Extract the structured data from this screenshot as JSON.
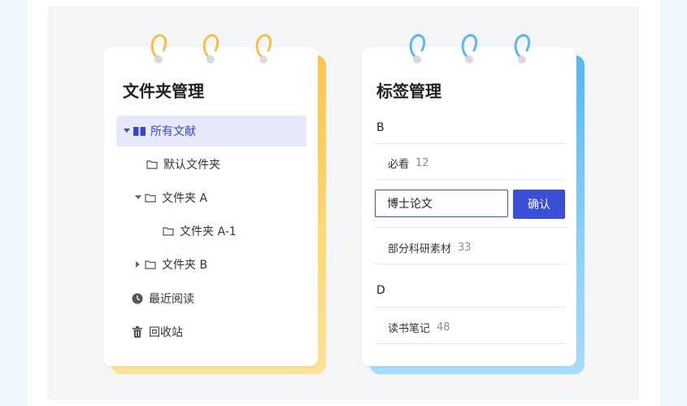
{
  "colors": {
    "accent": "#3b4ed6",
    "active_bg": "#e6e9fa",
    "yellow_ring": "#f3c04a",
    "blue_ring": "#5db6ef"
  },
  "folder_panel": {
    "title": "文件夹管理",
    "items": [
      {
        "label": "所有文献",
        "icon": "book-icon",
        "caret": "caret-down-icon",
        "active": true
      },
      {
        "label": "默认文件夹",
        "icon": "folder-icon"
      },
      {
        "label": "文件夹 A",
        "icon": "folder-icon",
        "caret": "caret-down-icon"
      },
      {
        "label": "文件夹 A-1",
        "icon": "folder-icon"
      },
      {
        "label": "文件夹 B",
        "icon": "folder-icon",
        "caret": "caret-right-icon"
      },
      {
        "label": "最近阅读",
        "icon": "clock-icon"
      },
      {
        "label": "回收站",
        "icon": "trash-icon"
      }
    ]
  },
  "tag_panel": {
    "title": "标签管理",
    "sections": [
      {
        "letter": "B"
      },
      {
        "letter": "D"
      }
    ],
    "tags": [
      {
        "name": "必看",
        "count": "12"
      },
      {
        "name": "部分科研素材",
        "count": "33"
      },
      {
        "name": "读书笔记",
        "count": "48"
      }
    ],
    "edit": {
      "value": "博士论文",
      "confirm_label": "确认"
    }
  }
}
